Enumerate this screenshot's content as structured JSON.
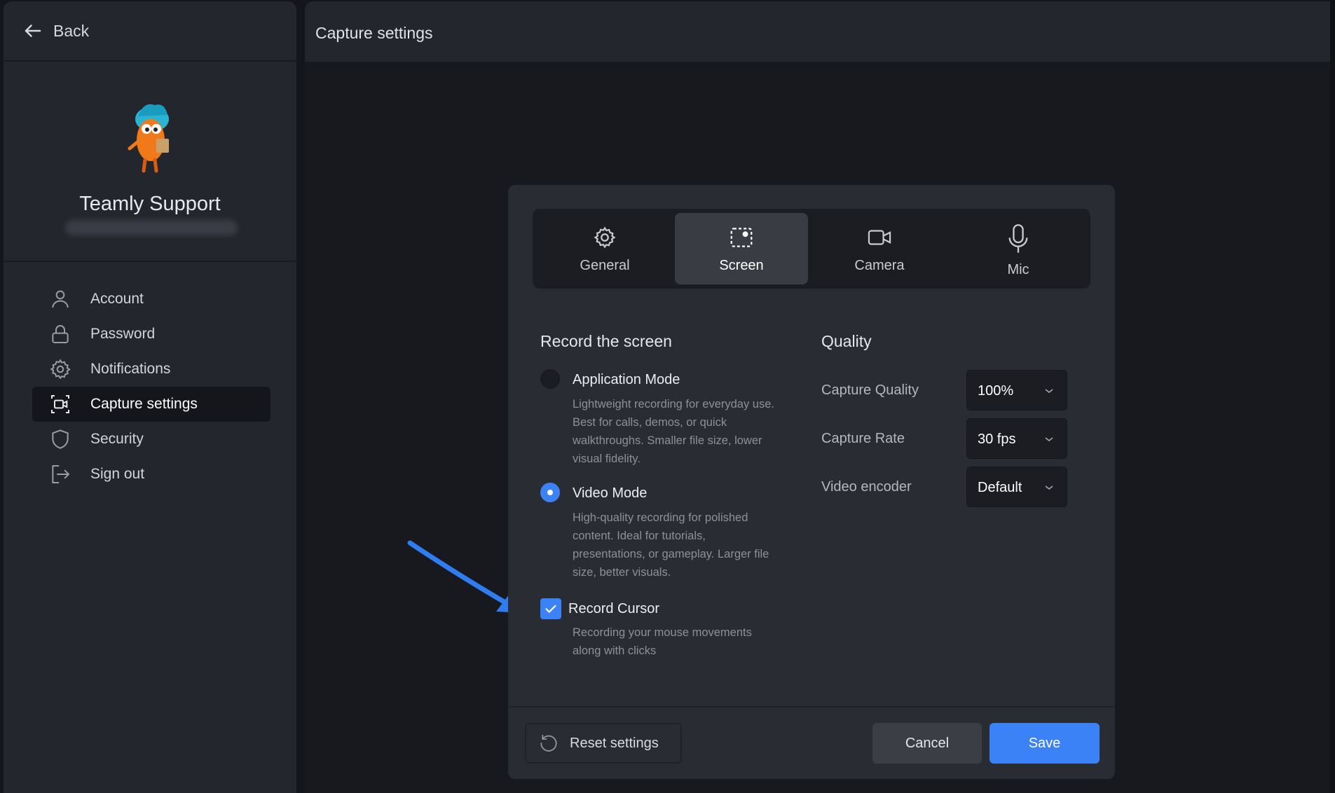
{
  "sidebar": {
    "back_label": "Back",
    "profile": {
      "name": "Teamly Support"
    },
    "nav": [
      {
        "label": "Account",
        "icon": "user-icon"
      },
      {
        "label": "Password",
        "icon": "lock-icon"
      },
      {
        "label": "Notifications",
        "icon": "gear-icon"
      },
      {
        "label": "Capture settings",
        "icon": "capture-icon",
        "active": true
      },
      {
        "label": "Security",
        "icon": "shield-icon"
      },
      {
        "label": "Sign out",
        "icon": "sign-out-icon"
      }
    ]
  },
  "header": {
    "title": "Capture settings"
  },
  "dialog": {
    "tabs": [
      {
        "label": "General",
        "icon": "gear-icon"
      },
      {
        "label": "Screen",
        "icon": "screen-select-icon",
        "active": true
      },
      {
        "label": "Camera",
        "icon": "camera-icon"
      },
      {
        "label": "Mic",
        "icon": "microphone-icon"
      }
    ],
    "record": {
      "title": "Record the screen",
      "app_mode": {
        "title": "Application Mode",
        "desc_lines": [
          "Lightweight recording for everyday use.",
          "Best for calls, demos, or quick",
          "walkthroughs. Smaller file size, lower",
          "visual fidelity."
        ],
        "selected": false
      },
      "video_mode": {
        "title": "Video Mode",
        "desc_lines": [
          "High-quality recording for polished",
          "content. Ideal for tutorials,",
          "presentations, or gameplay. Larger file",
          "size, better visuals."
        ],
        "selected": true
      },
      "cursor": {
        "title": "Record Cursor",
        "desc_lines": [
          "Recording your mouse movements",
          "along with clicks"
        ],
        "checked": true
      }
    },
    "quality": {
      "title": "Quality",
      "capture_quality": {
        "label": "Capture Quality",
        "value": "100%"
      },
      "capture_rate": {
        "label": "Capture Rate",
        "value": "30 fps"
      },
      "video_encoder": {
        "label": "Video encoder",
        "value": "Default"
      }
    },
    "footer": {
      "reset_label": "Reset settings",
      "cancel_label": "Cancel",
      "save_label": "Save"
    }
  },
  "colors": {
    "accent": "#3b82f6",
    "panel": "#24262d",
    "background": "#15161b"
  }
}
